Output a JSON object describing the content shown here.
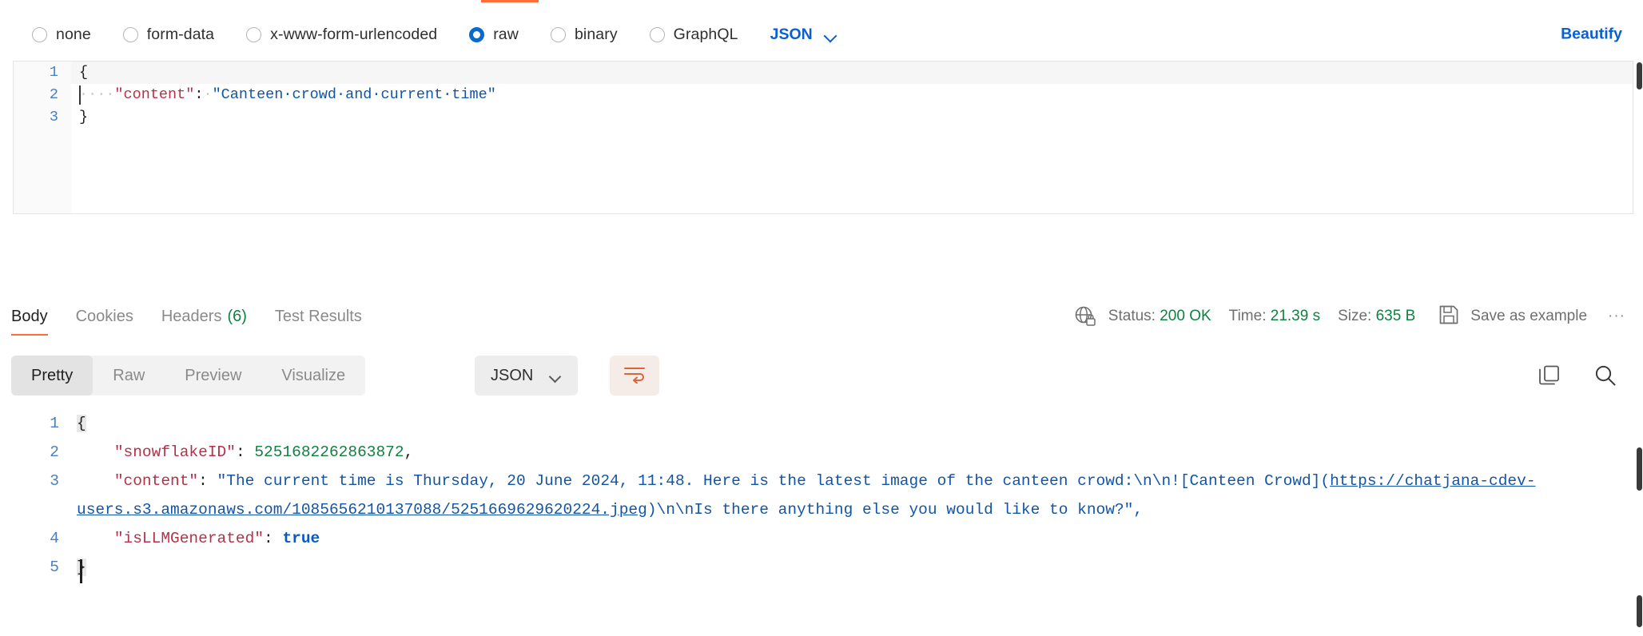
{
  "theme": {
    "accent": "#ff6c37",
    "link": "#0b5fd0",
    "success": "#118040",
    "key_color": "#b4314a",
    "string_color": "#1255a8"
  },
  "body_type": {
    "options": [
      {
        "label": "none",
        "checked": false
      },
      {
        "label": "form-data",
        "checked": false
      },
      {
        "label": "x-www-form-urlencoded",
        "checked": false
      },
      {
        "label": "raw",
        "checked": true
      },
      {
        "label": "binary",
        "checked": false
      },
      {
        "label": "GraphQL",
        "checked": false
      }
    ],
    "format": "JSON",
    "beautify_label": "Beautify"
  },
  "request_editor": {
    "lines": [
      {
        "no": "1",
        "active": true
      },
      {
        "no": "2",
        "active": false
      },
      {
        "no": "3",
        "active": false
      }
    ],
    "line1_open": "{",
    "line2_indent": "····",
    "line2_key": "\"content\"",
    "line2_colon": ":",
    "line2_sep": "·",
    "line2_value": "\"Canteen·crowd·and·current·time\"",
    "line3_close": "}"
  },
  "response_tabs": [
    {
      "label": "Body",
      "active": true,
      "count": ""
    },
    {
      "label": "Cookies",
      "active": false,
      "count": ""
    },
    {
      "label": "Headers",
      "active": false,
      "count": "(6)"
    },
    {
      "label": "Test Results",
      "active": false,
      "count": ""
    }
  ],
  "response_status": {
    "status_label": "Status:",
    "status_value": "200 OK",
    "time_label": "Time:",
    "time_value": "21.39 s",
    "size_label": "Size:",
    "size_value": "635 B",
    "save_as_example": "Save as example",
    "more_menu": "···"
  },
  "response_toolbar": {
    "segments": [
      {
        "label": "Pretty",
        "active": true
      },
      {
        "label": "Raw",
        "active": false
      },
      {
        "label": "Preview",
        "active": false
      },
      {
        "label": "Visualize",
        "active": false
      }
    ],
    "format": "JSON"
  },
  "response_body": {
    "lines": [
      {
        "no": "1"
      },
      {
        "no": "2"
      },
      {
        "no": "3"
      },
      {
        "no": "4"
      },
      {
        "no": "5"
      }
    ],
    "open_brace": "{",
    "close_brace": "}",
    "snowflake_key": "\"snowflakeID\"",
    "snowflake_value": "5251682262863872",
    "content_key": "\"content\"",
    "content_part1": "\"The current time is Thursday, 20 June 2024, 11:48. Here is the latest image of the canteen crowd:\\n\\n![Canteen Crowd](",
    "content_url": "https://chatjana-cdev-users.s3.amazonaws.com/1085656210137088/5251669629620224.jpeg",
    "content_part2": ")\\n\\nIs there anything else you would like to know?\",",
    "isllm_key": "\"isLLMGenerated\"",
    "isllm_value": "true"
  }
}
